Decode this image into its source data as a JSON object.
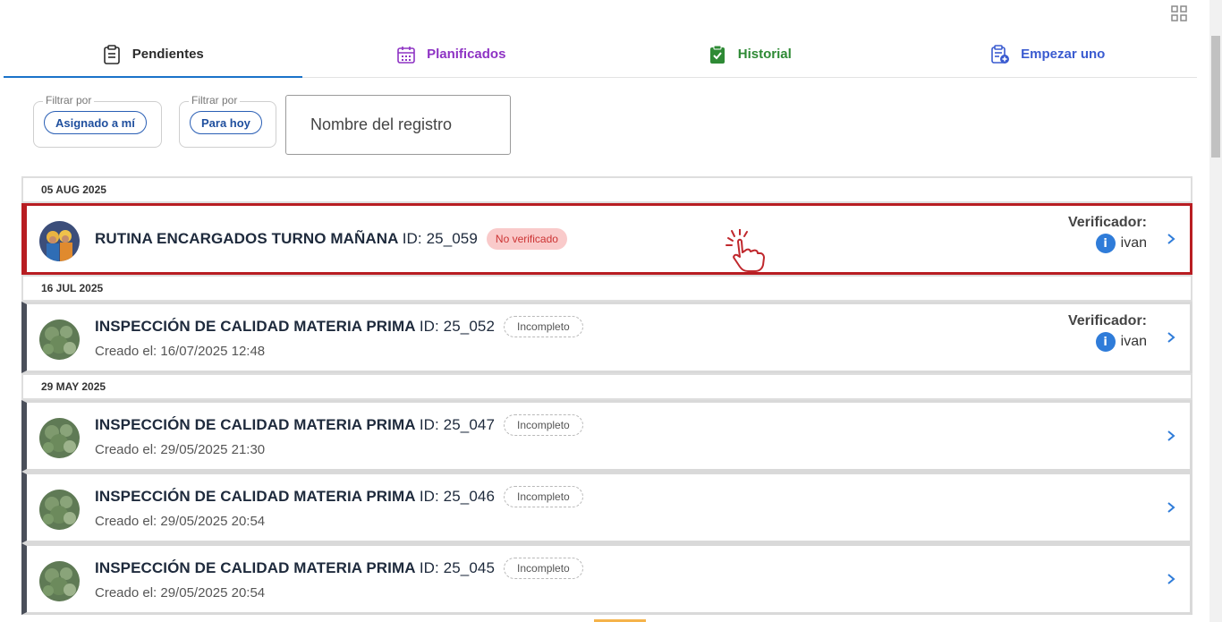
{
  "tabs": [
    {
      "label": "Pendientes",
      "icon": "clipboard-list-icon",
      "color": "#2b2b2b",
      "active": true
    },
    {
      "label": "Planificados",
      "icon": "calendar-icon",
      "color": "#8e33c4",
      "active": false
    },
    {
      "label": "Historial",
      "icon": "clipboard-check-icon",
      "color": "#2e8a35",
      "active": false
    },
    {
      "label": "Empezar uno",
      "icon": "clipboard-add-icon",
      "color": "#3a5bd0",
      "active": false
    }
  ],
  "filters": [
    {
      "legend": "Filtrar por",
      "chip": "Asignado a mí"
    },
    {
      "legend": "Filtrar por",
      "chip": "Para hoy"
    }
  ],
  "search": {
    "placeholder": "Nombre del registro"
  },
  "groups": [
    {
      "date": "05 AUG 2025",
      "records": [
        {
          "title": "RUTINA ENCARGADOS TURNO MAÑANA",
          "id_text": "ID: 25_059",
          "badge": "No verificado",
          "badge_type": "red",
          "created": "",
          "verifier_label": "Verificador:",
          "verifier": "ivan",
          "highlight": true
        }
      ]
    },
    {
      "date": "16 JUL 2025",
      "records": [
        {
          "title": "INSPECCIÓN DE CALIDAD MATERIA PRIMA",
          "id_text": "ID: 25_052",
          "badge": "Incompleto",
          "badge_type": "incomplete",
          "created": "Creado el: 16/07/2025 12:48",
          "verifier_label": "Verificador:",
          "verifier": "ivan",
          "highlight": false
        }
      ]
    },
    {
      "date": "29 MAY 2025",
      "records": [
        {
          "title": "INSPECCIÓN DE CALIDAD MATERIA PRIMA",
          "id_text": "ID: 25_047",
          "badge": "Incompleto",
          "badge_type": "incomplete",
          "created": "Creado el: 29/05/2025 21:30",
          "verifier_label": "",
          "verifier": "",
          "highlight": false
        },
        {
          "title": "INSPECCIÓN DE CALIDAD MATERIA PRIMA",
          "id_text": "ID: 25_046",
          "badge": "Incompleto",
          "badge_type": "incomplete",
          "created": "Creado el: 29/05/2025 20:54",
          "verifier_label": "",
          "verifier": "",
          "highlight": false
        },
        {
          "title": "INSPECCIÓN DE CALIDAD MATERIA PRIMA",
          "id_text": "ID: 25_045",
          "badge": "Incompleto",
          "badge_type": "incomplete",
          "created": "Creado el: 29/05/2025 20:54",
          "verifier_label": "",
          "verifier": "",
          "highlight": false
        }
      ]
    }
  ],
  "info_icon_glyph": "i",
  "colors": {
    "accent_blue": "#1a73c9",
    "highlight_red": "#b81d22",
    "badge_red_bg": "#f9caca",
    "chip_blue": "#2a5fb5"
  }
}
